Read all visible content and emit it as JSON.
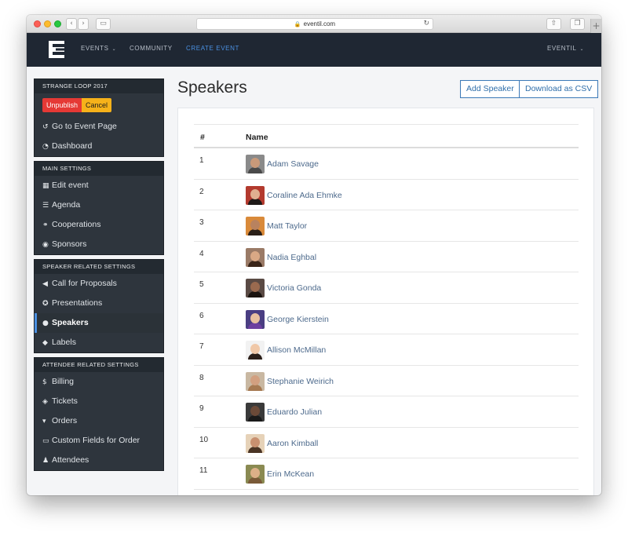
{
  "browser": {
    "url": "eventil.com",
    "back_icon": "chevron-left-icon",
    "forward_icon": "chevron-right-icon"
  },
  "navbar": {
    "links": [
      {
        "label": "EVENTS",
        "has_dropdown": true
      },
      {
        "label": "COMMUNITY",
        "has_dropdown": false
      },
      {
        "label": "CREATE EVENT",
        "has_dropdown": false,
        "active": true
      }
    ],
    "user_menu": {
      "label": "EVENTIL",
      "has_dropdown": true
    },
    "accent_color": "#4a90e2",
    "background_color": "#1f2733"
  },
  "sidebar": {
    "event_panel": {
      "title": "STRANGE LOOP 2017",
      "unpublish_label": "Unpublish",
      "cancel_label": "Cancel",
      "items": [
        {
          "label": "Go to Event Page",
          "icon": "undo-icon"
        },
        {
          "label": "Dashboard",
          "icon": "dashboard-icon"
        }
      ]
    },
    "main_settings": {
      "title": "MAIN SETTINGS",
      "items": [
        {
          "label": "Edit event",
          "icon": "calendar-icon"
        },
        {
          "label": "Agenda",
          "icon": "list-icon"
        },
        {
          "label": "Cooperations",
          "icon": "handshake-icon"
        },
        {
          "label": "Sponsors",
          "icon": "user-circle-icon"
        }
      ]
    },
    "speaker_settings": {
      "title": "SPEAKER RELATED SETTINGS",
      "items": [
        {
          "label": "Call for Proposals",
          "icon": "bullhorn-icon"
        },
        {
          "label": "Presentations",
          "icon": "lightbulb-icon"
        },
        {
          "label": "Speakers",
          "icon": "users-icon",
          "active": true
        },
        {
          "label": "Labels",
          "icon": "tags-icon"
        }
      ]
    },
    "attendee_settings": {
      "title": "ATTENDEE RELATED SETTINGS",
      "items": [
        {
          "label": "Billing",
          "icon": "dollar-icon"
        },
        {
          "label": "Tickets",
          "icon": "ticket-icon"
        },
        {
          "label": "Orders",
          "icon": "basket-icon"
        },
        {
          "label": "Custom Fields for Order",
          "icon": "desktop-icon"
        },
        {
          "label": "Attendees",
          "icon": "user-plus-icon"
        }
      ]
    }
  },
  "main": {
    "title": "Speakers",
    "add_speaker_label": "Add Speaker",
    "download_csv_label": "Download as CSV",
    "table": {
      "headers": [
        "#",
        "Name"
      ],
      "rows": [
        {
          "num": "1",
          "name": "Adam Savage"
        },
        {
          "num": "2",
          "name": "Coraline Ada Ehmke"
        },
        {
          "num": "3",
          "name": "Matt Taylor"
        },
        {
          "num": "4",
          "name": "Nadia Eghbal"
        },
        {
          "num": "5",
          "name": "Victoria Gonda"
        },
        {
          "num": "6",
          "name": "George Kierstein"
        },
        {
          "num": "7",
          "name": "Allison McMillan"
        },
        {
          "num": "8",
          "name": "Stephanie Weirich"
        },
        {
          "num": "9",
          "name": "Eduardo Julian"
        },
        {
          "num": "10",
          "name": "Aaron Kimball"
        },
        {
          "num": "11",
          "name": "Erin McKean"
        }
      ]
    }
  }
}
